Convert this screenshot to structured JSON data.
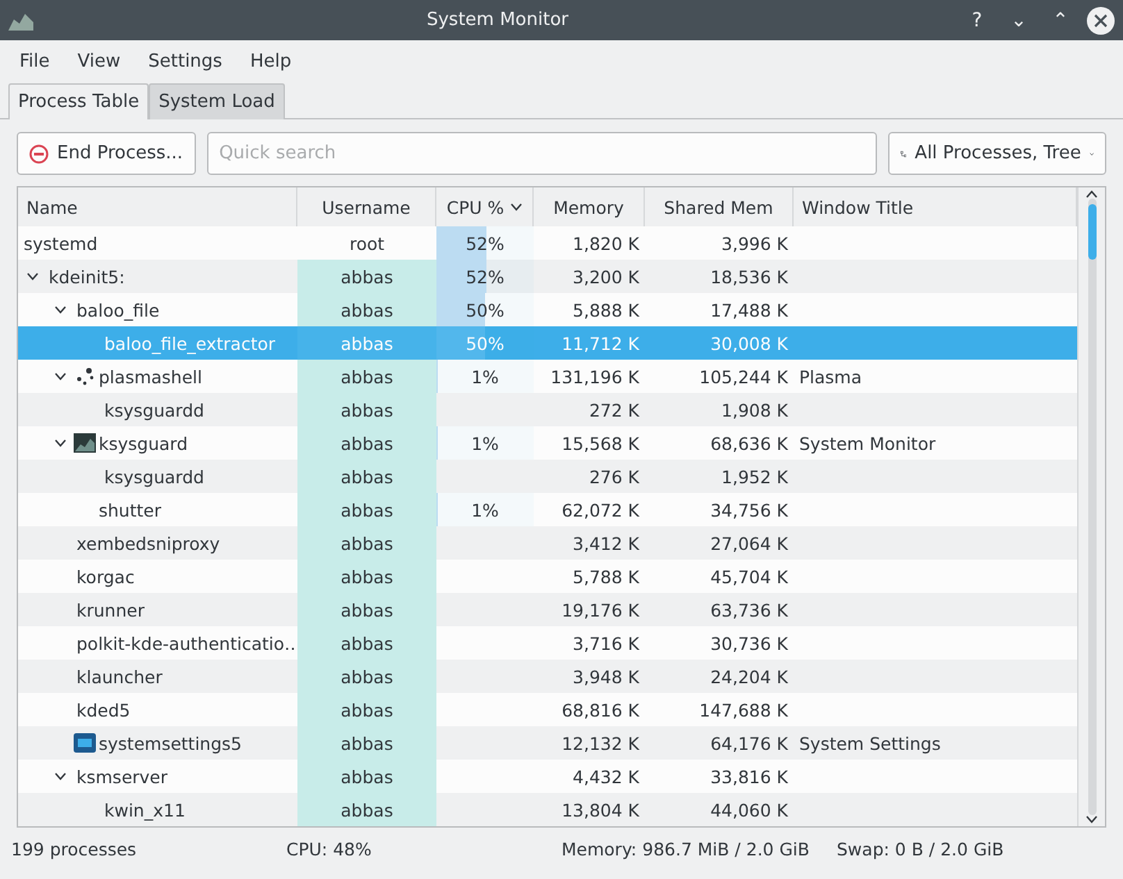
{
  "window": {
    "title": "System Monitor",
    "buttons": [
      "?",
      "⌄",
      "⌃"
    ]
  },
  "menu": [
    "File",
    "View",
    "Settings",
    "Help"
  ],
  "tabs": [
    {
      "label": "Process Table",
      "selected": true
    },
    {
      "label": "System Load",
      "selected": false
    }
  ],
  "toolbar": {
    "end_button": "End Process...",
    "search": {
      "placeholder": "Quick search"
    },
    "filter": "All Processes, Tree"
  },
  "table": {
    "columns": [
      {
        "label": "Name",
        "sorted": false
      },
      {
        "label": "Username",
        "sorted": false
      },
      {
        "label": "CPU %",
        "sorted": true
      },
      {
        "label": "Memory",
        "sorted": false
      },
      {
        "label": "Shared Mem",
        "sorted": false
      },
      {
        "label": "Window Title",
        "sorted": false
      }
    ],
    "rows": [
      {
        "name": "systemd",
        "user": "root",
        "own": false,
        "cpu": "52%",
        "level": 0.52,
        "memory": "1,820 K",
        "shared": "3,996 K",
        "selected": false
      },
      {
        "name": "kdeinit5:",
        "user": "abbas",
        "own": true,
        "cpu": "52%",
        "level": 0.52,
        "memory": "3,200 K",
        "shared": "18,536 K",
        "selected": false,
        "expanded": true,
        "children": [
          {
            "name": "baloo_file",
            "user": "abbas",
            "own": true,
            "cpu": "50%",
            "level": 0.5,
            "memory": "5,888 K",
            "shared": "17,488 K",
            "selected": false,
            "expanded": true,
            "children": [
              {
                "name": "baloo_file_extractor",
                "user": "abbas",
                "own": true,
                "cpu": "50%",
                "level": 0.5,
                "memory": "11,712 K",
                "shared": "30,008 K",
                "selected": true
              }
            ]
          },
          {
            "name": "plasmashell",
            "kind": "plasma",
            "user": "abbas",
            "own": true,
            "cpu": "1%",
            "level": 0.01,
            "memory": "131,196 K",
            "shared": "105,244 K",
            "title": "Plasma",
            "selected": false,
            "expanded": true,
            "children": [
              {
                "name": "ksysguardd",
                "user": "abbas",
                "own": true,
                "memory": "272 K",
                "shared": "1,908 K",
                "selected": false
              }
            ]
          },
          {
            "name": "ksysguard",
            "kind": "monitor",
            "user": "abbas",
            "own": true,
            "cpu": "1%",
            "level": 0.01,
            "memory": "15,568 K",
            "shared": "68,636 K",
            "title": "System Monitor",
            "selected": false,
            "expanded": true,
            "children": [
              {
                "name": "ksysguardd",
                "user": "abbas",
                "own": true,
                "memory": "276 K",
                "shared": "1,952 K",
                "selected": false
              }
            ]
          },
          {
            "name": "shutter",
            "kind": "blank",
            "user": "abbas",
            "own": true,
            "cpu": "1%",
            "level": 0.01,
            "memory": "62,072 K",
            "shared": "34,756 K",
            "selected": false
          },
          {
            "name": "xembedsniproxy",
            "user": "abbas",
            "own": true,
            "memory": "3,412 K",
            "shared": "27,064 K",
            "selected": false
          },
          {
            "name": "korgac",
            "user": "abbas",
            "own": true,
            "memory": "5,788 K",
            "shared": "45,704 K",
            "selected": false
          },
          {
            "name": "krunner",
            "user": "abbas",
            "own": true,
            "memory": "19,176 K",
            "shared": "63,736 K",
            "selected": false
          },
          {
            "name": "polkit-kde-authenticatio…",
            "user": "abbas",
            "own": true,
            "memory": "3,716 K",
            "shared": "30,736 K",
            "selected": false
          },
          {
            "name": "klauncher",
            "user": "abbas",
            "own": true,
            "memory": "3,948 K",
            "shared": "24,204 K",
            "selected": false
          },
          {
            "name": "kded5",
            "user": "abbas",
            "own": true,
            "memory": "68,816 K",
            "shared": "147,688 K",
            "selected": false
          },
          {
            "name": "systemsettings5",
            "kind": "settings",
            "user": "abbas",
            "own": true,
            "memory": "12,132 K",
            "shared": "64,176 K",
            "title": "System Settings",
            "selected": false
          },
          {
            "name": "ksmserver",
            "user": "abbas",
            "own": true,
            "memory": "4,432 K",
            "shared": "33,816 K",
            "selected": false,
            "expanded": true,
            "children": [
              {
                "name": "kwin_x11",
                "user": "abbas",
                "own": true,
                "memory": "13,804 K",
                "shared": "44,060 K",
                "selected": false
              }
            ]
          }
        ]
      }
    ]
  },
  "status_bar": [
    "199 processes",
    "CPU: 48%",
    "Memory: 986.7 MiB / 2.0 GiB",
    "Swap: 0 B / 2.0 GiB"
  ]
}
